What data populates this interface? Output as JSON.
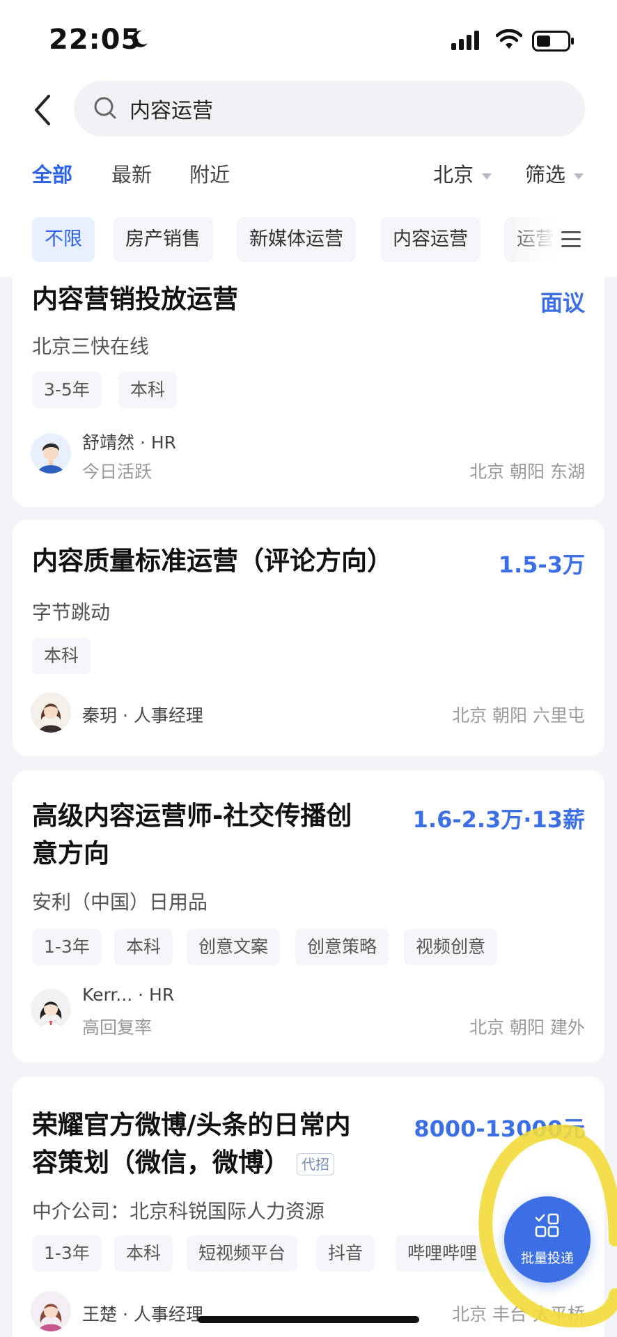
{
  "status_bar": {
    "time": "22:05"
  },
  "search": {
    "query": "内容运营"
  },
  "tabs": [
    {
      "label": "全部"
    },
    {
      "label": "最新"
    },
    {
      "label": "附近"
    }
  ],
  "filters": {
    "city": "北京",
    "filter": "筛选"
  },
  "chips": [
    {
      "label": "不限"
    },
    {
      "label": "房产销售"
    },
    {
      "label": "新媒体运营"
    },
    {
      "label": "内容运营"
    },
    {
      "label": "运营"
    }
  ],
  "jobs": [
    {
      "title": "内容营销投放运营",
      "salary": "面议",
      "company": "北京三快在线",
      "tags": [
        "3-5年",
        "本科"
      ],
      "recruiter": "舒靖然 · HR",
      "activity": "今日活跃",
      "location": "北京 朝阳 东湖"
    },
    {
      "title": "内容质量标准运营（评论方向）",
      "salary": "1.5-3万",
      "company": "字节跳动",
      "tags": [
        "本科"
      ],
      "recruiter": "秦玥 · 人事经理",
      "location": "北京 朝阳 六里屯"
    },
    {
      "title_line1": "高级内容运营师-社交传播创",
      "title_line2": "意方向",
      "salary": "1.6-2.3万·13薪",
      "company": "安利（中国）日用品",
      "tags": [
        "1-3年",
        "本科",
        "创意文案",
        "创意策略",
        "视频创意"
      ],
      "recruiter": "Kerr... · HR",
      "activity": "高回复率",
      "location": "北京 朝阳 建外"
    },
    {
      "title_line1": "荣耀官方微博/头条的日常内",
      "title_line2": "容策划（微信，微博）",
      "badge": "代招",
      "salary": "8000-13000元",
      "company": "中介公司：北京科锐国际人力资源",
      "tags": [
        "1-3年",
        "本科",
        "短视频平台",
        "抖音",
        "哔哩哔哩"
      ],
      "recruiter": "王楚 · 人事经理",
      "location": "北京 丰台 太平桥"
    }
  ],
  "fab": {
    "label": "批量投递"
  },
  "colors": {
    "accent": "#3b6fe3",
    "highlight": "#f2dc3a"
  }
}
